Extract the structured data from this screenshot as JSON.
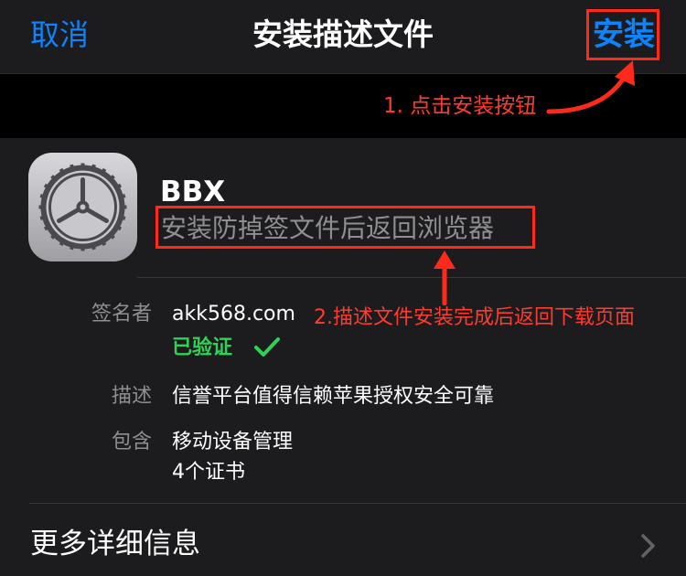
{
  "nav": {
    "cancel_label": "取消",
    "title": "安装描述文件",
    "install_label": "安装"
  },
  "annotations": {
    "step1": "1. 点击安装按钮",
    "step2": "2.描述文件安装完成后返回下载页面"
  },
  "profile": {
    "icon": "settings-gear-icon",
    "name": "BBX",
    "subtitle": "安装防掉签文件后返回浏览器"
  },
  "details": {
    "signer_label": "签名者",
    "signer_value": "akk568.com",
    "verified_text": "已验证",
    "description_label": "描述",
    "description_value": "信誉平台值得信赖苹果授权安全可靠",
    "contains_label": "包含",
    "contains_line1": "移动设备管理",
    "contains_line2": "4个证书"
  },
  "more_info_label": "更多详细信息",
  "colors": {
    "accent_blue": "#0a84ff",
    "annotation_red": "#ff3b30",
    "verified_green": "#30d158",
    "background": "#1c1c1e"
  }
}
